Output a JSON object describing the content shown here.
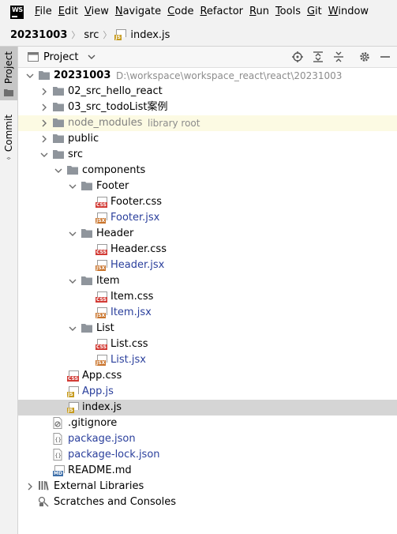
{
  "menu": [
    "File",
    "Edit",
    "View",
    "Navigate",
    "Code",
    "Refactor",
    "Run",
    "Tools",
    "Git",
    "Window"
  ],
  "breadcrumb": [
    "20231003",
    "src",
    "index.js"
  ],
  "left_tabs": [
    "Project",
    "Commit"
  ],
  "panel": {
    "title": "Project"
  },
  "tree": [
    {
      "label": "20231003",
      "hint": "D:\\workspace\\workspace_react\\react\\20231003",
      "bold": true,
      "level": 0,
      "icon": "folder-icon",
      "chev": "down"
    },
    {
      "label": "02_src_hello_react",
      "level": 1,
      "icon": "folder-icon",
      "chev": "right"
    },
    {
      "label": "03_src_todoList案例",
      "level": 1,
      "icon": "folder-icon",
      "chev": "right"
    },
    {
      "label": "node_modules",
      "hint": "library root",
      "level": 1,
      "icon": "folder-icon",
      "chev": "right",
      "excluded": true
    },
    {
      "label": "public",
      "level": 1,
      "icon": "folder-icon",
      "chev": "right"
    },
    {
      "label": "src",
      "level": 1,
      "icon": "folder-icon",
      "chev": "down"
    },
    {
      "label": "components",
      "level": 2,
      "icon": "folder-icon",
      "chev": "down"
    },
    {
      "label": "Footer",
      "level": 3,
      "icon": "folder-icon",
      "chev": "down"
    },
    {
      "label": "Footer.css",
      "level": 4,
      "icon": "css-file-icon"
    },
    {
      "label": "Footer.jsx",
      "level": 4,
      "icon": "jsx-file-icon",
      "blue": true
    },
    {
      "label": "Header",
      "level": 3,
      "icon": "folder-icon",
      "chev": "down"
    },
    {
      "label": "Header.css",
      "level": 4,
      "icon": "css-file-icon"
    },
    {
      "label": "Header.jsx",
      "level": 4,
      "icon": "jsx-file-icon",
      "blue": true
    },
    {
      "label": "Item",
      "level": 3,
      "icon": "folder-icon",
      "chev": "down"
    },
    {
      "label": "Item.css",
      "level": 4,
      "icon": "css-file-icon"
    },
    {
      "label": "Item.jsx",
      "level": 4,
      "icon": "jsx-file-icon",
      "blue": true
    },
    {
      "label": "List",
      "level": 3,
      "icon": "folder-icon",
      "chev": "down"
    },
    {
      "label": "List.css",
      "level": 4,
      "icon": "css-file-icon"
    },
    {
      "label": "List.jsx",
      "level": 4,
      "icon": "jsx-file-icon",
      "blue": true
    },
    {
      "label": "App.css",
      "level": 2,
      "icon": "css-file-icon"
    },
    {
      "label": "App.js",
      "level": 2,
      "icon": "js-file-icon",
      "blue": true
    },
    {
      "label": "index.js",
      "level": 2,
      "icon": "js-file-icon",
      "selected": true
    },
    {
      "label": ".gitignore",
      "level": 1,
      "icon": "gitignore-file-icon"
    },
    {
      "label": "package.json",
      "level": 1,
      "icon": "json-file-icon",
      "blue": true
    },
    {
      "label": "package-lock.json",
      "level": 1,
      "icon": "json-file-icon",
      "blue": true
    },
    {
      "label": "README.md",
      "level": 1,
      "icon": "md-file-icon"
    },
    {
      "label": "External Libraries",
      "level": 0,
      "icon": "library-icon",
      "chev": "right"
    },
    {
      "label": "Scratches and Consoles",
      "level": 0,
      "icon": "scratches-icon"
    }
  ],
  "colors": {
    "folder": "#8f959c",
    "selected_row": "#d5d5d5",
    "excluded_row": "#fcfae3",
    "modified_text": "#2a3f9c",
    "css_tag": "#d23b35",
    "jsx_tag": "#c9742c",
    "js_tag": "#c69b1f",
    "md_tag": "#3d6ea8"
  }
}
